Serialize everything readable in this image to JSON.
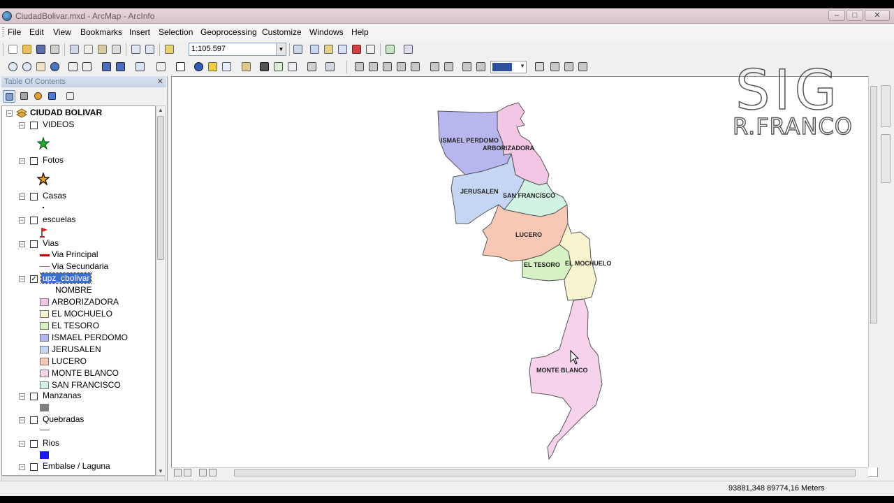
{
  "window": {
    "title": "CiudadBolivar.mxd - ArcMap - ArcInfo",
    "min_label": "–",
    "max_label": "□",
    "close_label": "✕"
  },
  "menu": {
    "items": [
      "File",
      "Edit",
      "View",
      "Bookmarks",
      "Insert",
      "Selection",
      "Geoprocessing",
      "Customize",
      "Windows",
      "Help"
    ]
  },
  "toolbar": {
    "scale_value": "1:105.597"
  },
  "toc": {
    "title": "Table Of Contents",
    "close_label": "✕",
    "dataframe": "CIUDAD BOLIVAR",
    "layers": {
      "videos": "VIDEOS",
      "fotos": "Fotos",
      "casas": "Casas",
      "escuelas": "escuelas",
      "vias": "Vias",
      "via_principal": "Via Principal",
      "via_secundaria": "Via Secundaria",
      "upz": "upz_cbolivar",
      "upz_field": "NOMBRE",
      "manzanas": "Manzanas",
      "quebradas": "Quebradas",
      "rios": "Rios",
      "embalse": "Embalse / Laguna"
    },
    "upz_classes": [
      {
        "label": "ARBORIZADORA",
        "color": "#f4c6e6"
      },
      {
        "label": "EL MOCHUELO",
        "color": "#f7f4cf"
      },
      {
        "label": "EL TESORO",
        "color": "#d6f2c4"
      },
      {
        "label": "ISMAEL PERDOMO",
        "color": "#b7b6ef"
      },
      {
        "label": "JERUSALEN",
        "color": "#c4d6f4"
      },
      {
        "label": "LUCERO",
        "color": "#f8c8b6"
      },
      {
        "label": "MONTE BLANCO",
        "color": "#f6d2ec"
      },
      {
        "label": "SAN FRANCISCO",
        "color": "#d2f3e4"
      }
    ],
    "icons": {
      "videos_symbol": "green-star-icon",
      "fotos_symbol": "orange-star-icon",
      "escuelas_symbol": "red-flag-icon",
      "manzanas_color": "#7f7f7f",
      "rios_color": "#1a1aff",
      "via_principal_color": "#c00000",
      "via_secundaria_color": "#b07070"
    }
  },
  "map": {
    "labels": {
      "ismael_perdomo": "ISMAEL PERDOMO",
      "arborizadora": "ARBORIZADORA",
      "jerusalen": "JERUSALEN",
      "san_francisco": "SAN FRANCISCO",
      "lucero": "LUCERO",
      "el_tesoro": "EL TESORO",
      "el_mochuelo": "EL MOCHUELO",
      "monte_blanco": "MONTE BLANCO"
    }
  },
  "watermark": {
    "line1": "SIG",
    "line2": "R.FRANCO"
  },
  "status": {
    "coords": "93881,348  89774,16 Meters"
  }
}
